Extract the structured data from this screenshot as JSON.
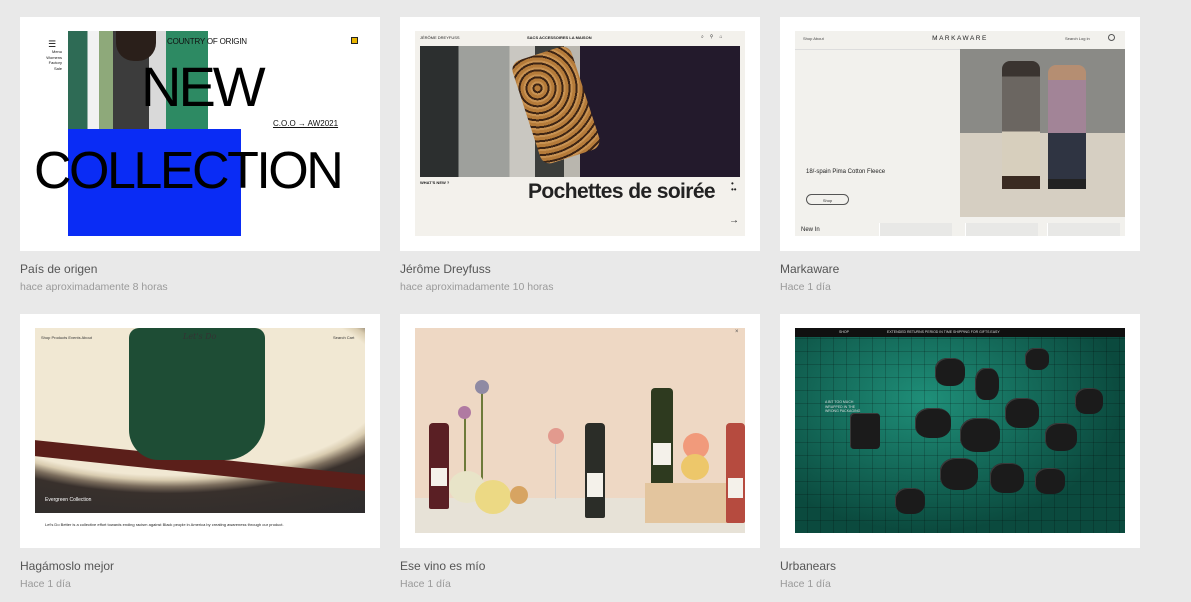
{
  "cards": [
    {
      "title": "País de origen",
      "time": "hace aproximadamente 8 horas",
      "preview": {
        "menu_items": [
          "Menu",
          "Womens",
          "Factory Sale"
        ],
        "brand": "COUNTRY OF ORIGIN",
        "headline_1": "NEW",
        "headline_2": "COLLECTION",
        "season": "C.O.O → AW2021"
      }
    },
    {
      "title": "Jérôme Dreyfuss",
      "time": "hace aproximadamente 10 horas",
      "preview": {
        "brand": "JÉRÔME DREYFUSS",
        "nav": "SACS   ACCESSOIRES   LA MAISON",
        "section": "WHAT'S NEW ?",
        "headline": "Pochettes de soirée"
      }
    },
    {
      "title": "Markaware",
      "time": "Hace 1 día",
      "preview": {
        "nav_left": "Shop   About",
        "brand": "MARKAWARE",
        "nav_right": "Search   Log in",
        "product": "18/-spain Pima Cotton Fleece",
        "button": "Shop",
        "section": "New In"
      }
    },
    {
      "title": "Hagámoslo mejor",
      "time": "Hace 1 día",
      "preview": {
        "nav_left": "Shop   Products   Events   About",
        "logo": "Let's Do",
        "nav_right": "Search   Cart",
        "collection": "Evergreen Collection",
        "footer_text": "Let's Do Better is a collective effort towards ending racism against Black people in America by creating awareness through our product."
      }
    },
    {
      "title": "Ese vino es mío",
      "time": "Hace 1 día",
      "preview": {}
    },
    {
      "title": "Urbanears",
      "time": "Hace 1 día",
      "preview": {
        "menu": "SHOP",
        "announcement": "EXTENDED RETURNS PERIOD IN TIME SHIPPING FOR GIFTS EASY",
        "side_text": "A BIT TOO MUCH WRAPPED IN THE WRONG PACKAGING"
      }
    }
  ]
}
